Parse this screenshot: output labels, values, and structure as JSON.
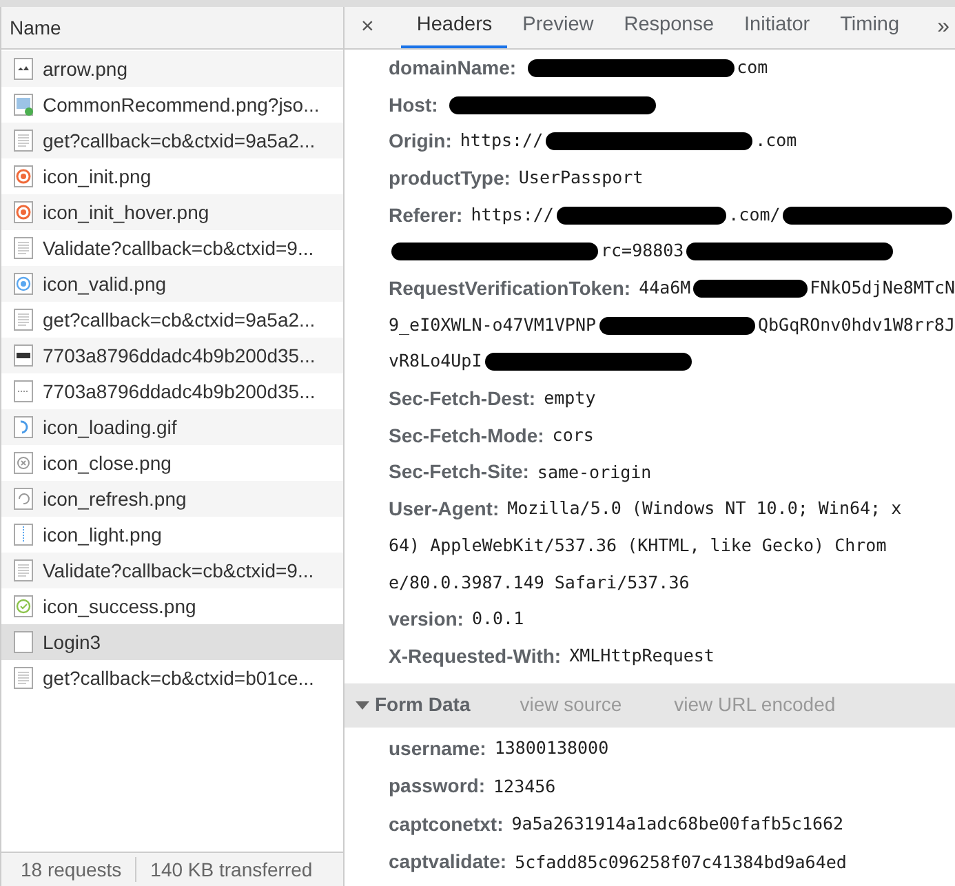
{
  "requests_panel": {
    "column_header": "Name",
    "requests": [
      {
        "name": "arrow.png",
        "kind": "arrow",
        "selected": false
      },
      {
        "name": "CommonRecommend.png?jso...",
        "kind": "picture",
        "selected": false
      },
      {
        "name": "get?callback=cb&ctxid=9a5a2...",
        "kind": "script",
        "selected": false
      },
      {
        "name": "icon_init.png",
        "kind": "init",
        "selected": false
      },
      {
        "name": "icon_init_hover.png",
        "kind": "init",
        "selected": false
      },
      {
        "name": "Validate?callback=cb&ctxid=9...",
        "kind": "script",
        "selected": false
      },
      {
        "name": "icon_valid.png",
        "kind": "valid",
        "selected": false
      },
      {
        "name": "get?callback=cb&ctxid=9a5a2...",
        "kind": "script",
        "selected": false
      },
      {
        "name": "7703a8796ddadc4b9b200d35...",
        "kind": "strip",
        "selected": false
      },
      {
        "name": "7703a8796ddadc4b9b200d35...",
        "kind": "dots",
        "selected": false
      },
      {
        "name": "icon_loading.gif",
        "kind": "loading",
        "selected": false
      },
      {
        "name": "icon_close.png",
        "kind": "close",
        "selected": false
      },
      {
        "name": "icon_refresh.png",
        "kind": "refresh",
        "selected": false
      },
      {
        "name": "icon_light.png",
        "kind": "light",
        "selected": false
      },
      {
        "name": "Validate?callback=cb&ctxid=9...",
        "kind": "script",
        "selected": false
      },
      {
        "name": "icon_success.png",
        "kind": "success",
        "selected": false
      },
      {
        "name": "Login3",
        "kind": "blank",
        "selected": true
      },
      {
        "name": "get?callback=cb&ctxid=b01ce...",
        "kind": "script",
        "selected": false
      }
    ],
    "status_bar": {
      "requests": "18 requests",
      "transferred": "140 KB transferred"
    }
  },
  "details_panel": {
    "close": "×",
    "tabs": [
      {
        "label": "Headers",
        "selected": true
      },
      {
        "label": "Preview",
        "selected": false
      },
      {
        "label": "Response",
        "selected": false
      },
      {
        "label": "Initiator",
        "selected": false
      },
      {
        "label": "Timing",
        "selected": false
      }
    ],
    "more": "»",
    "headers": [
      {
        "name": "domainName:",
        "lines": [
          [
            {
              "kind": "redaction"
            },
            {
              "kind": "text",
              "text": "com"
            }
          ]
        ]
      },
      {
        "name": "Host:",
        "lines": [
          [
            {
              "kind": "redaction"
            }
          ]
        ]
      },
      {
        "name": "Origin:",
        "lines": [
          [
            {
              "kind": "text",
              "text": "https://"
            },
            {
              "kind": "redaction"
            },
            {
              "kind": "text",
              "text": ".com"
            }
          ]
        ]
      },
      {
        "name": "productType:",
        "lines": [
          [
            {
              "kind": "text",
              "text": "UserPassport"
            }
          ]
        ]
      },
      {
        "name": "Referer:",
        "lines": [
          [
            {
              "kind": "text",
              "text": "https://"
            },
            {
              "kind": "redaction"
            },
            {
              "kind": "text",
              "text": ".com/"
            },
            {
              "kind": "redaction"
            }
          ],
          [
            {
              "kind": "redaction"
            },
            {
              "kind": "text",
              "text": "rc=98803"
            },
            {
              "kind": "redaction"
            }
          ]
        ]
      },
      {
        "name": "RequestVerificationToken:",
        "lines": [
          [
            {
              "kind": "text",
              "text": "44a6M"
            },
            {
              "kind": "redaction"
            },
            {
              "kind": "text",
              "text": "FNkO5djNe8MTcN"
            }
          ],
          [
            {
              "kind": "text",
              "text": "9_eI0XWLN-o47VM1VPNP"
            },
            {
              "kind": "redaction"
            },
            {
              "kind": "text",
              "text": "QbGqROnv0hdv1W8rr8J"
            }
          ],
          [
            {
              "kind": "text",
              "text": "vR8Lo4UpI"
            },
            {
              "kind": "redaction"
            }
          ]
        ]
      },
      {
        "name": "Sec-Fetch-Dest:",
        "lines": [
          [
            {
              "kind": "text",
              "text": "empty"
            }
          ]
        ]
      },
      {
        "name": "Sec-Fetch-Mode:",
        "lines": [
          [
            {
              "kind": "text",
              "text": "cors"
            }
          ]
        ]
      },
      {
        "name": "Sec-Fetch-Site:",
        "lines": [
          [
            {
              "kind": "text",
              "text": "same-origin"
            }
          ]
        ]
      },
      {
        "name": "User-Agent:",
        "lines": [
          [
            {
              "kind": "text",
              "text": "Mozilla/5.0 (Windows NT 10.0; Win64; x"
            }
          ],
          [
            {
              "kind": "text",
              "text": "64) AppleWebKit/537.36 (KHTML, like Gecko) Chrom"
            }
          ],
          [
            {
              "kind": "text",
              "text": "e/80.0.3987.149 Safari/537.36"
            }
          ]
        ]
      },
      {
        "name": "version:",
        "lines": [
          [
            {
              "kind": "text",
              "text": "0.0.1"
            }
          ]
        ]
      },
      {
        "name": "X-Requested-With:",
        "lines": [
          [
            {
              "kind": "text",
              "text": "XMLHttpRequest"
            }
          ]
        ]
      }
    ],
    "form_data": {
      "title": "Form Data",
      "expanded": true,
      "links": [
        "view source",
        "view URL encoded"
      ],
      "fields": [
        {
          "name": "username:",
          "value": "13800138000"
        },
        {
          "name": "password:",
          "value": "123456"
        },
        {
          "name": "captconetxt:",
          "value": "9a5a2631914a1adc68be00fafb5c1662"
        },
        {
          "name": "captvalidate:",
          "value": "5cfadd85c096258f07c41384bd9a64ed"
        }
      ]
    }
  }
}
